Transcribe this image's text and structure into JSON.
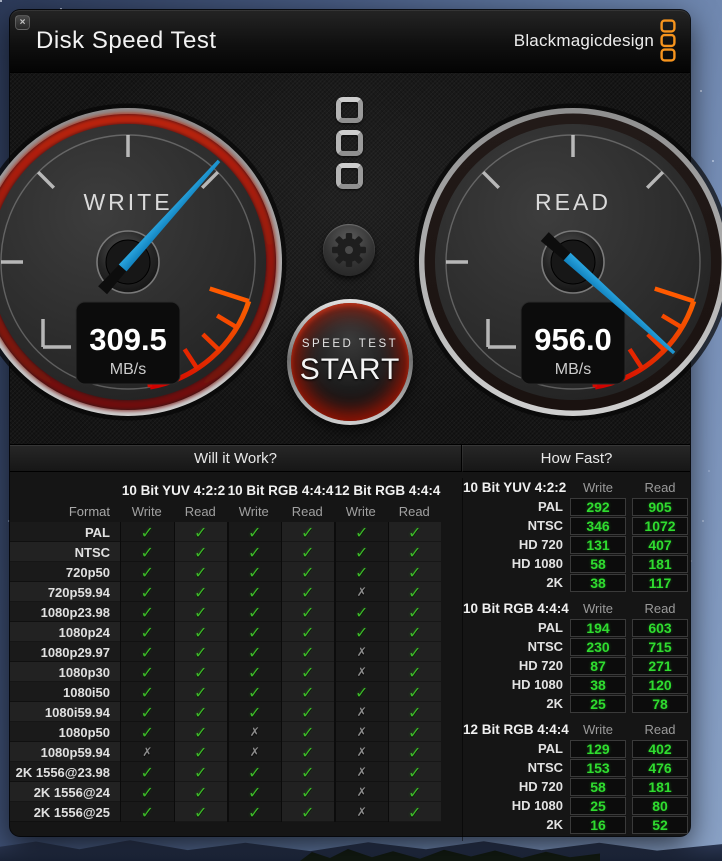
{
  "window": {
    "title": "Disk Speed Test",
    "brand": "Blackmagicdesign",
    "close_glyph": "×"
  },
  "gauges": {
    "write": {
      "label": "WRITE",
      "value": "309.5",
      "unit": "MB/s"
    },
    "read": {
      "label": "READ",
      "value": "956.0",
      "unit": "MB/s"
    }
  },
  "controls": {
    "start_sub": "SPEED TEST",
    "start_label": "START"
  },
  "tables": {
    "will_it_work": {
      "title": "Will it Work?",
      "format_header": "Format",
      "groups": [
        "10 Bit YUV 4:2:2",
        "10 Bit RGB 4:4:4",
        "12 Bit RGB 4:4:4"
      ],
      "sub_columns": [
        "Write",
        "Read"
      ],
      "check_glyph": "✓",
      "cross_glyph": "✗",
      "rows": [
        {
          "format": "PAL",
          "marks": [
            1,
            1,
            1,
            1,
            1,
            1
          ]
        },
        {
          "format": "NTSC",
          "marks": [
            1,
            1,
            1,
            1,
            1,
            1
          ]
        },
        {
          "format": "720p50",
          "marks": [
            1,
            1,
            1,
            1,
            1,
            1
          ]
        },
        {
          "format": "720p59.94",
          "marks": [
            1,
            1,
            1,
            1,
            0,
            1
          ]
        },
        {
          "format": "1080p23.98",
          "marks": [
            1,
            1,
            1,
            1,
            1,
            1
          ]
        },
        {
          "format": "1080p24",
          "marks": [
            1,
            1,
            1,
            1,
            1,
            1
          ]
        },
        {
          "format": "1080p29.97",
          "marks": [
            1,
            1,
            1,
            1,
            0,
            1
          ]
        },
        {
          "format": "1080p30",
          "marks": [
            1,
            1,
            1,
            1,
            0,
            1
          ]
        },
        {
          "format": "1080i50",
          "marks": [
            1,
            1,
            1,
            1,
            1,
            1
          ]
        },
        {
          "format": "1080i59.94",
          "marks": [
            1,
            1,
            1,
            1,
            0,
            1
          ]
        },
        {
          "format": "1080p50",
          "marks": [
            1,
            1,
            0,
            1,
            0,
            1
          ]
        },
        {
          "format": "1080p59.94",
          "marks": [
            0,
            1,
            0,
            1,
            0,
            1
          ]
        },
        {
          "format": "2K 1556@23.98",
          "marks": [
            1,
            1,
            1,
            1,
            0,
            1
          ]
        },
        {
          "format": "2K 1556@24",
          "marks": [
            1,
            1,
            1,
            1,
            0,
            1
          ]
        },
        {
          "format": "2K 1556@25",
          "marks": [
            1,
            1,
            1,
            1,
            0,
            1
          ]
        }
      ]
    },
    "how_fast": {
      "title": "How Fast?",
      "col_write": "Write",
      "col_read": "Read",
      "sections": [
        {
          "label": "10 Bit YUV 4:2:2",
          "rows": [
            {
              "format": "PAL",
              "write": 292,
              "read": 905
            },
            {
              "format": "NTSC",
              "write": 346,
              "read": 1072
            },
            {
              "format": "HD 720",
              "write": 131,
              "read": 407
            },
            {
              "format": "HD 1080",
              "write": 58,
              "read": 181
            },
            {
              "format": "2K",
              "write": 38,
              "read": 117
            }
          ]
        },
        {
          "label": "10 Bit RGB 4:4:4",
          "rows": [
            {
              "format": "PAL",
              "write": 194,
              "read": 603
            },
            {
              "format": "NTSC",
              "write": 230,
              "read": 715
            },
            {
              "format": "HD 720",
              "write": 87,
              "read": 271
            },
            {
              "format": "HD 1080",
              "write": 38,
              "read": 120
            },
            {
              "format": "2K",
              "write": 25,
              "read": 78
            }
          ]
        },
        {
          "label": "12 Bit RGB 4:4:4",
          "rows": [
            {
              "format": "PAL",
              "write": 129,
              "read": 402
            },
            {
              "format": "NTSC",
              "write": 153,
              "read": 476
            },
            {
              "format": "HD 720",
              "write": 58,
              "read": 181
            },
            {
              "format": "HD 1080",
              "write": 25,
              "read": 80
            },
            {
              "format": "2K",
              "write": 16,
              "read": 52
            }
          ]
        }
      ]
    }
  },
  "colors": {
    "accent_orange": "#f7941d",
    "check_green": "#3cb828",
    "value_green": "#2fdc2f",
    "needle_cyan": "#35b5e5",
    "glow_red": "#c22310"
  }
}
